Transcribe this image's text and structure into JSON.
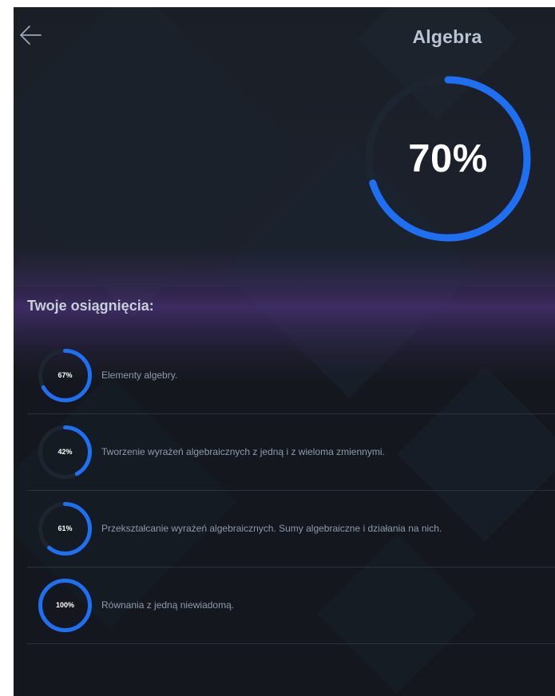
{
  "header": {
    "back_icon": "arrow-left-icon",
    "title": "Algebra"
  },
  "overall": {
    "percent_label": "70%",
    "progress": 0.7
  },
  "achievements": {
    "heading": "Twoje osiągnięcia:",
    "items": [
      {
        "percent_label": "67%",
        "progress": 0.67,
        "label": "Elementy algebry."
      },
      {
        "percent_label": "42%",
        "progress": 0.42,
        "label": "Tworzenie wyrażeń algebraicznych z jedną i z wieloma zmiennymi."
      },
      {
        "percent_label": "61%",
        "progress": 0.61,
        "label": "Przekształcanie wyrażeń algebraicznych. Sumy algebraiczne i działania na nich."
      },
      {
        "percent_label": "100%",
        "progress": 1.0,
        "label": "Równania z jedną niewiadomą."
      }
    ]
  },
  "colors": {
    "background": "#15191f",
    "accent": "#1f6ff2",
    "track": "#1d2630",
    "glow": "#5b3a8c"
  }
}
